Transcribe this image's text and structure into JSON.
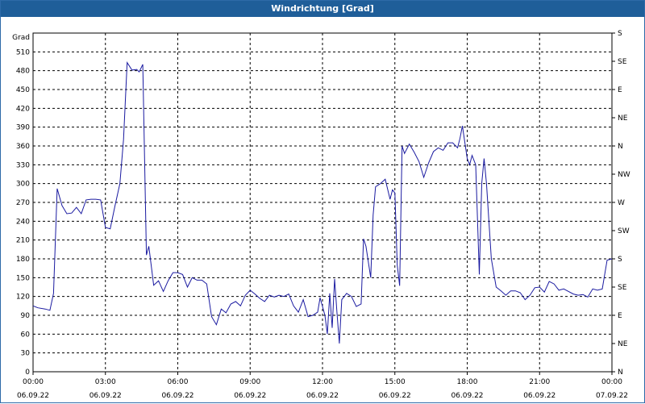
{
  "window": {
    "title": "Windrichtung [Grad]"
  },
  "chart_data": {
    "type": "line",
    "title": "Windrichtung [Grad]",
    "ylabel": "Grad",
    "ylim": [
      0,
      540
    ],
    "y_ticks": [
      0,
      30,
      60,
      90,
      120,
      150,
      180,
      210,
      240,
      270,
      300,
      330,
      360,
      390,
      420,
      450,
      480,
      510
    ],
    "right_ticks": [
      "N",
      "NE",
      "E",
      "SE",
      "S",
      "SW",
      "W",
      "NW",
      "N",
      "NE",
      "E",
      "SE",
      "S"
    ],
    "x_ticks": [
      {
        "hour": 0,
        "time": "00:00",
        "date": "06.09.22"
      },
      {
        "hour": 3,
        "time": "03:00",
        "date": "06.09.22"
      },
      {
        "hour": 6,
        "time": "06:00",
        "date": "06.09.22"
      },
      {
        "hour": 9,
        "time": "09:00",
        "date": "06.09.22"
      },
      {
        "hour": 12,
        "time": "12:00",
        "date": "06.09.22"
      },
      {
        "hour": 15,
        "time": "15:00",
        "date": "06.09.22"
      },
      {
        "hour": 18,
        "time": "18:00",
        "date": "06.09.22"
      },
      {
        "hour": 21,
        "time": "21:00",
        "date": "06.09.22"
      },
      {
        "hour": 24,
        "time": "00:00",
        "date": "07.09.22"
      }
    ],
    "xlim": [
      0,
      24
    ],
    "grid": true,
    "line_color": "#1a1aa0",
    "series": [
      {
        "x": [
          0.0,
          0.2,
          0.5,
          0.7,
          0.85,
          1.0,
          1.2,
          1.4,
          1.6,
          1.8,
          2.0,
          2.2,
          2.4,
          2.6,
          2.8,
          3.0,
          3.2,
          3.4,
          3.6,
          3.75,
          3.9,
          4.1,
          4.3,
          4.4,
          4.55,
          4.7,
          4.8,
          5.0,
          5.2,
          5.4,
          5.6,
          5.8,
          6.0,
          6.2,
          6.4,
          6.6,
          6.8,
          7.0,
          7.2,
          7.4,
          7.6,
          7.8,
          8.0,
          8.2,
          8.4,
          8.6,
          8.8,
          9.0,
          9.2,
          9.4,
          9.6,
          9.8,
          10.0,
          10.2,
          10.4,
          10.6,
          10.8,
          11.0,
          11.2,
          11.4,
          11.6,
          11.8,
          11.9,
          12.0,
          12.1,
          12.2,
          12.3,
          12.4,
          12.5,
          12.6,
          12.7,
          12.8,
          13.0,
          13.2,
          13.4,
          13.6,
          13.7,
          13.8,
          14.0,
          14.1,
          14.2,
          14.4,
          14.6,
          14.8,
          14.9,
          15.0,
          15.1,
          15.2,
          15.3,
          15.4,
          15.6,
          15.8,
          16.0,
          16.2,
          16.4,
          16.6,
          16.8,
          17.0,
          17.2,
          17.4,
          17.6,
          17.7,
          17.8,
          18.0,
          18.1,
          18.2,
          18.35,
          18.5,
          18.6,
          18.7,
          18.8,
          19.0,
          19.2,
          19.4,
          19.6,
          19.8,
          20.0,
          20.2,
          20.4,
          20.6,
          20.8,
          21.0,
          21.2,
          21.4,
          21.6,
          21.8,
          22.0,
          22.2,
          22.4,
          22.6,
          22.8,
          23.0,
          23.2,
          23.4,
          23.6,
          23.8,
          24.0
        ],
        "y": [
          105,
          102,
          100,
          98,
          125,
          292,
          265,
          252,
          253,
          262,
          252,
          274,
          275,
          275,
          274,
          230,
          228,
          265,
          300,
          370,
          493,
          481,
          482,
          478,
          490,
          186,
          200,
          138,
          145,
          128,
          145,
          158,
          158,
          155,
          135,
          150,
          146,
          146,
          140,
          88,
          75,
          100,
          94,
          108,
          112,
          105,
          122,
          130,
          124,
          117,
          112,
          122,
          119,
          122,
          120,
          124,
          105,
          95,
          115,
          88,
          90,
          95,
          118,
          104,
          90,
          60,
          125,
          70,
          148,
          95,
          45,
          115,
          125,
          120,
          104,
          108,
          212,
          200,
          150,
          250,
          295,
          300,
          307,
          275,
          290,
          285,
          170,
          137,
          360,
          348,
          363,
          350,
          335,
          310,
          333,
          351,
          357,
          353,
          365,
          365,
          357,
          372,
          392,
          340,
          330,
          345,
          330,
          155,
          300,
          340,
          300,
          180,
          135,
          129,
          122,
          129,
          129,
          126,
          115,
          122,
          134,
          135,
          127,
          144,
          140,
          130,
          132,
          128,
          124,
          122,
          123,
          119,
          132,
          130,
          132,
          178,
          180
        ]
      }
    ]
  }
}
